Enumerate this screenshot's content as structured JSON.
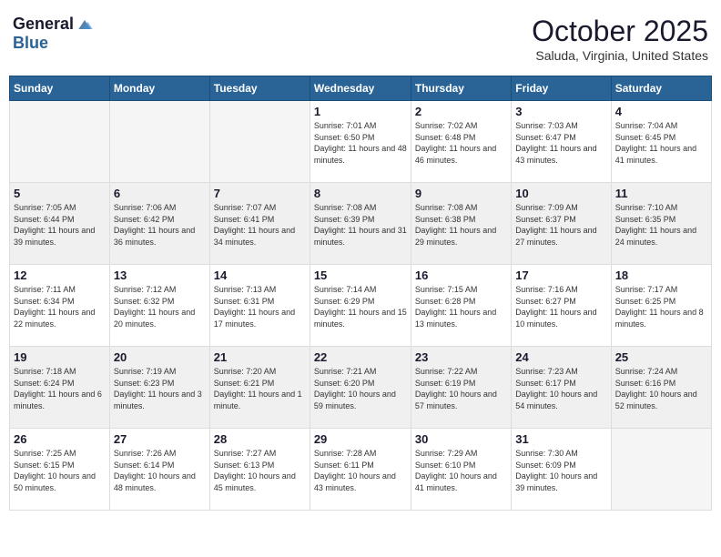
{
  "logo": {
    "general": "General",
    "blue": "Blue"
  },
  "title": "October 2025",
  "location": "Saluda, Virginia, United States",
  "days_of_week": [
    "Sunday",
    "Monday",
    "Tuesday",
    "Wednesday",
    "Thursday",
    "Friday",
    "Saturday"
  ],
  "weeks": [
    {
      "shaded": false,
      "days": [
        {
          "date": "",
          "sunrise": "",
          "sunset": "",
          "daylight": ""
        },
        {
          "date": "",
          "sunrise": "",
          "sunset": "",
          "daylight": ""
        },
        {
          "date": "",
          "sunrise": "",
          "sunset": "",
          "daylight": ""
        },
        {
          "date": "1",
          "sunrise": "Sunrise: 7:01 AM",
          "sunset": "Sunset: 6:50 PM",
          "daylight": "Daylight: 11 hours and 48 minutes."
        },
        {
          "date": "2",
          "sunrise": "Sunrise: 7:02 AM",
          "sunset": "Sunset: 6:48 PM",
          "daylight": "Daylight: 11 hours and 46 minutes."
        },
        {
          "date": "3",
          "sunrise": "Sunrise: 7:03 AM",
          "sunset": "Sunset: 6:47 PM",
          "daylight": "Daylight: 11 hours and 43 minutes."
        },
        {
          "date": "4",
          "sunrise": "Sunrise: 7:04 AM",
          "sunset": "Sunset: 6:45 PM",
          "daylight": "Daylight: 11 hours and 41 minutes."
        }
      ]
    },
    {
      "shaded": true,
      "days": [
        {
          "date": "5",
          "sunrise": "Sunrise: 7:05 AM",
          "sunset": "Sunset: 6:44 PM",
          "daylight": "Daylight: 11 hours and 39 minutes."
        },
        {
          "date": "6",
          "sunrise": "Sunrise: 7:06 AM",
          "sunset": "Sunset: 6:42 PM",
          "daylight": "Daylight: 11 hours and 36 minutes."
        },
        {
          "date": "7",
          "sunrise": "Sunrise: 7:07 AM",
          "sunset": "Sunset: 6:41 PM",
          "daylight": "Daylight: 11 hours and 34 minutes."
        },
        {
          "date": "8",
          "sunrise": "Sunrise: 7:08 AM",
          "sunset": "Sunset: 6:39 PM",
          "daylight": "Daylight: 11 hours and 31 minutes."
        },
        {
          "date": "9",
          "sunrise": "Sunrise: 7:08 AM",
          "sunset": "Sunset: 6:38 PM",
          "daylight": "Daylight: 11 hours and 29 minutes."
        },
        {
          "date": "10",
          "sunrise": "Sunrise: 7:09 AM",
          "sunset": "Sunset: 6:37 PM",
          "daylight": "Daylight: 11 hours and 27 minutes."
        },
        {
          "date": "11",
          "sunrise": "Sunrise: 7:10 AM",
          "sunset": "Sunset: 6:35 PM",
          "daylight": "Daylight: 11 hours and 24 minutes."
        }
      ]
    },
    {
      "shaded": false,
      "days": [
        {
          "date": "12",
          "sunrise": "Sunrise: 7:11 AM",
          "sunset": "Sunset: 6:34 PM",
          "daylight": "Daylight: 11 hours and 22 minutes."
        },
        {
          "date": "13",
          "sunrise": "Sunrise: 7:12 AM",
          "sunset": "Sunset: 6:32 PM",
          "daylight": "Daylight: 11 hours and 20 minutes."
        },
        {
          "date": "14",
          "sunrise": "Sunrise: 7:13 AM",
          "sunset": "Sunset: 6:31 PM",
          "daylight": "Daylight: 11 hours and 17 minutes."
        },
        {
          "date": "15",
          "sunrise": "Sunrise: 7:14 AM",
          "sunset": "Sunset: 6:29 PM",
          "daylight": "Daylight: 11 hours and 15 minutes."
        },
        {
          "date": "16",
          "sunrise": "Sunrise: 7:15 AM",
          "sunset": "Sunset: 6:28 PM",
          "daylight": "Daylight: 11 hours and 13 minutes."
        },
        {
          "date": "17",
          "sunrise": "Sunrise: 7:16 AM",
          "sunset": "Sunset: 6:27 PM",
          "daylight": "Daylight: 11 hours and 10 minutes."
        },
        {
          "date": "18",
          "sunrise": "Sunrise: 7:17 AM",
          "sunset": "Sunset: 6:25 PM",
          "daylight": "Daylight: 11 hours and 8 minutes."
        }
      ]
    },
    {
      "shaded": true,
      "days": [
        {
          "date": "19",
          "sunrise": "Sunrise: 7:18 AM",
          "sunset": "Sunset: 6:24 PM",
          "daylight": "Daylight: 11 hours and 6 minutes."
        },
        {
          "date": "20",
          "sunrise": "Sunrise: 7:19 AM",
          "sunset": "Sunset: 6:23 PM",
          "daylight": "Daylight: 11 hours and 3 minutes."
        },
        {
          "date": "21",
          "sunrise": "Sunrise: 7:20 AM",
          "sunset": "Sunset: 6:21 PM",
          "daylight": "Daylight: 11 hours and 1 minute."
        },
        {
          "date": "22",
          "sunrise": "Sunrise: 7:21 AM",
          "sunset": "Sunset: 6:20 PM",
          "daylight": "Daylight: 10 hours and 59 minutes."
        },
        {
          "date": "23",
          "sunrise": "Sunrise: 7:22 AM",
          "sunset": "Sunset: 6:19 PM",
          "daylight": "Daylight: 10 hours and 57 minutes."
        },
        {
          "date": "24",
          "sunrise": "Sunrise: 7:23 AM",
          "sunset": "Sunset: 6:17 PM",
          "daylight": "Daylight: 10 hours and 54 minutes."
        },
        {
          "date": "25",
          "sunrise": "Sunrise: 7:24 AM",
          "sunset": "Sunset: 6:16 PM",
          "daylight": "Daylight: 10 hours and 52 minutes."
        }
      ]
    },
    {
      "shaded": false,
      "days": [
        {
          "date": "26",
          "sunrise": "Sunrise: 7:25 AM",
          "sunset": "Sunset: 6:15 PM",
          "daylight": "Daylight: 10 hours and 50 minutes."
        },
        {
          "date": "27",
          "sunrise": "Sunrise: 7:26 AM",
          "sunset": "Sunset: 6:14 PM",
          "daylight": "Daylight: 10 hours and 48 minutes."
        },
        {
          "date": "28",
          "sunrise": "Sunrise: 7:27 AM",
          "sunset": "Sunset: 6:13 PM",
          "daylight": "Daylight: 10 hours and 45 minutes."
        },
        {
          "date": "29",
          "sunrise": "Sunrise: 7:28 AM",
          "sunset": "Sunset: 6:11 PM",
          "daylight": "Daylight: 10 hours and 43 minutes."
        },
        {
          "date": "30",
          "sunrise": "Sunrise: 7:29 AM",
          "sunset": "Sunset: 6:10 PM",
          "daylight": "Daylight: 10 hours and 41 minutes."
        },
        {
          "date": "31",
          "sunrise": "Sunrise: 7:30 AM",
          "sunset": "Sunset: 6:09 PM",
          "daylight": "Daylight: 10 hours and 39 minutes."
        },
        {
          "date": "",
          "sunrise": "",
          "sunset": "",
          "daylight": ""
        }
      ]
    }
  ]
}
